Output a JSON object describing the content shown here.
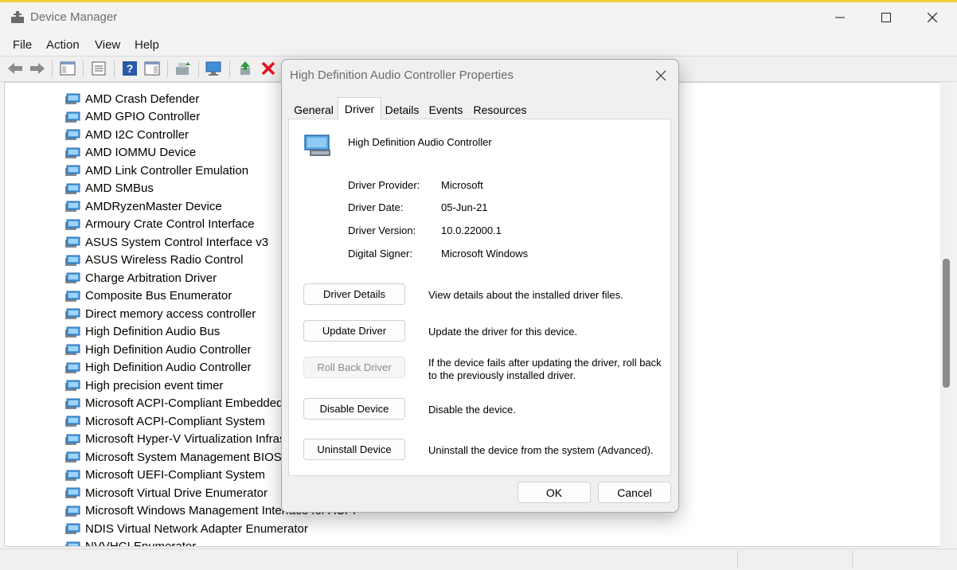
{
  "window": {
    "title": "Device Manager",
    "menu": [
      "File",
      "Action",
      "View",
      "Help"
    ]
  },
  "toolbar": {
    "icons": [
      "back-arrow-icon",
      "forward-arrow-icon",
      "show-hide-console-tree-icon",
      "properties-icon",
      "help-icon",
      "action-pane-icon",
      "update-driver-icon",
      "scan-hardware-icon",
      "enable-device-icon",
      "uninstall-device-icon"
    ],
    "uninstall_color": "#e81123"
  },
  "tree": {
    "items": [
      "AMD Crash Defender",
      "AMD GPIO Controller",
      "AMD I2C Controller",
      "AMD IOMMU Device",
      "AMD Link Controller Emulation",
      "AMD SMBus",
      "AMDRyzenMaster Device",
      "Armoury Crate Control Interface",
      "ASUS System Control Interface v3",
      "ASUS Wireless Radio Control",
      "Charge Arbitration Driver",
      "Composite Bus Enumerator",
      "Direct memory access controller",
      "High Definition Audio Bus",
      "High Definition Audio Controller",
      "High Definition Audio Controller",
      "High precision event timer",
      "Microsoft ACPI-Compliant Embedded",
      "Microsoft ACPI-Compliant System",
      "Microsoft Hyper-V Virtualization Infras",
      "Microsoft System Management BIOS D",
      "Microsoft UEFI-Compliant System",
      "Microsoft Virtual Drive Enumerator",
      "Microsoft Windows Management Interface for ACPI",
      "NDIS Virtual Network Adapter Enumerator",
      "NVVHCI Enumerator"
    ]
  },
  "dialog": {
    "title": "High Definition Audio Controller Properties",
    "tabs": [
      "General",
      "Driver",
      "Details",
      "Events",
      "Resources"
    ],
    "active_tab": "Driver",
    "device_name": "High Definition Audio Controller",
    "props": [
      {
        "label": "Driver Provider:",
        "value": "Microsoft"
      },
      {
        "label": "Driver Date:",
        "value": "05-Jun-21"
      },
      {
        "label": "Driver Version:",
        "value": "10.0.22000.1"
      },
      {
        "label": "Digital Signer:",
        "value": "Microsoft Windows"
      }
    ],
    "actions": [
      {
        "label": "Driver Details",
        "desc": "View details about the installed driver files.",
        "enabled": true
      },
      {
        "label": "Update Driver",
        "desc": "Update the driver for this device.",
        "enabled": true
      },
      {
        "label": "Roll Back Driver",
        "desc": "If the device fails after updating the driver, roll back to the previously installed driver.",
        "enabled": false
      },
      {
        "label": "Disable Device",
        "desc": "Disable the device.",
        "enabled": true
      },
      {
        "label": "Uninstall Device",
        "desc": "Uninstall the device from the system (Advanced).",
        "enabled": true
      }
    ],
    "ok_label": "OK",
    "cancel_label": "Cancel"
  }
}
